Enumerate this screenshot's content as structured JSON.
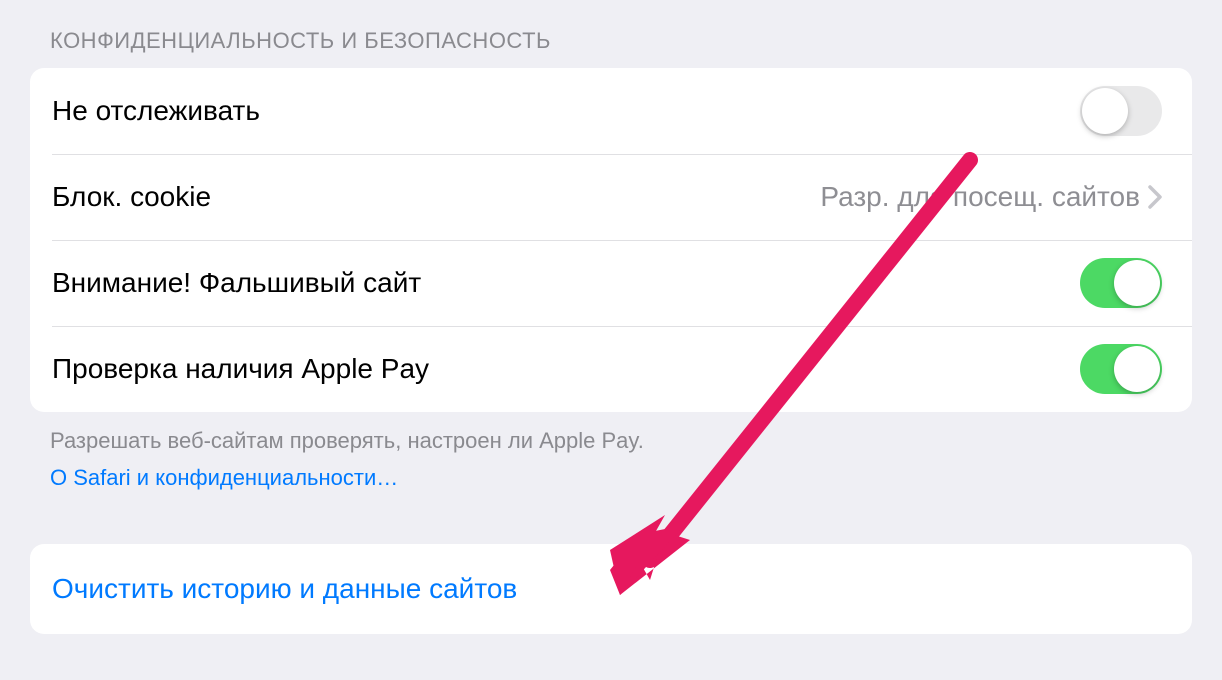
{
  "section_title": "КОНФИДЕНЦИАЛЬНОСТЬ И БЕЗОПАСНОСТЬ",
  "rows": {
    "do_not_track": {
      "label": "Не отслеживать",
      "toggle_on": false
    },
    "block_cookies": {
      "label": "Блок. cookie",
      "value": "Разр. для посещ. сайтов"
    },
    "fraud_warning": {
      "label": "Внимание! Фальшивый сайт",
      "toggle_on": true
    },
    "apple_pay_check": {
      "label": "Проверка наличия Apple Pay",
      "toggle_on": true
    }
  },
  "footer_text": "Разрешать веб-сайтам проверять, настроен ли Apple Pay.",
  "footer_link": "О Safari и конфиденциальности…",
  "clear_action": "Очистить историю и данные сайтов"
}
